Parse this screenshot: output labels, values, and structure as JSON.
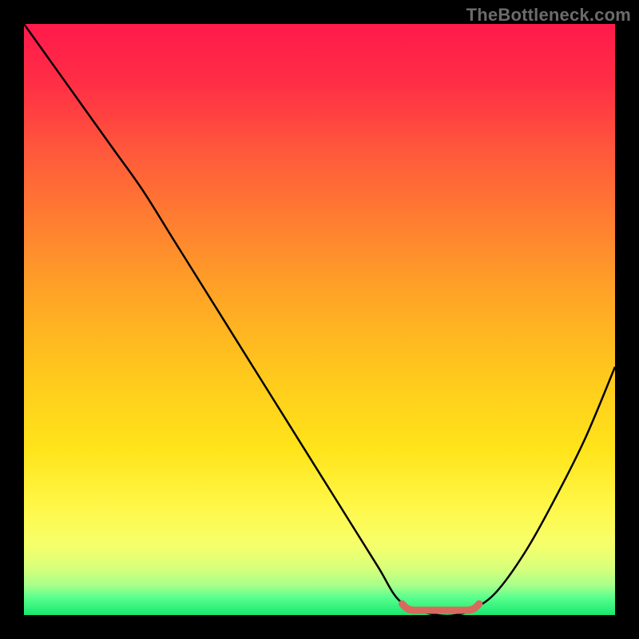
{
  "watermark": "TheBottleneck.com",
  "chart_data": {
    "type": "line",
    "title": "",
    "xlabel": "",
    "ylabel": "",
    "xlim": [
      0,
      100
    ],
    "ylim": [
      0,
      100
    ],
    "grid": false,
    "series": [
      {
        "name": "bottleneck-curve",
        "x": [
          0,
          5,
          10,
          15,
          20,
          25,
          30,
          35,
          40,
          45,
          50,
          55,
          60,
          63,
          66,
          70,
          73,
          76,
          80,
          85,
          90,
          95,
          100
        ],
        "y": [
          100,
          93,
          86,
          79,
          72,
          64,
          56,
          48,
          40,
          32,
          24,
          16,
          8,
          3,
          1,
          0,
          0,
          1,
          4,
          11,
          20,
          30,
          42
        ]
      }
    ],
    "annotations": [
      {
        "name": "optimal-range",
        "x_start": 64,
        "x_end": 77,
        "y": 0.5
      }
    ],
    "background_gradient": {
      "top": "#ff1a4b",
      "mid": "#ffe41a",
      "bottom": "#17e86e"
    }
  }
}
